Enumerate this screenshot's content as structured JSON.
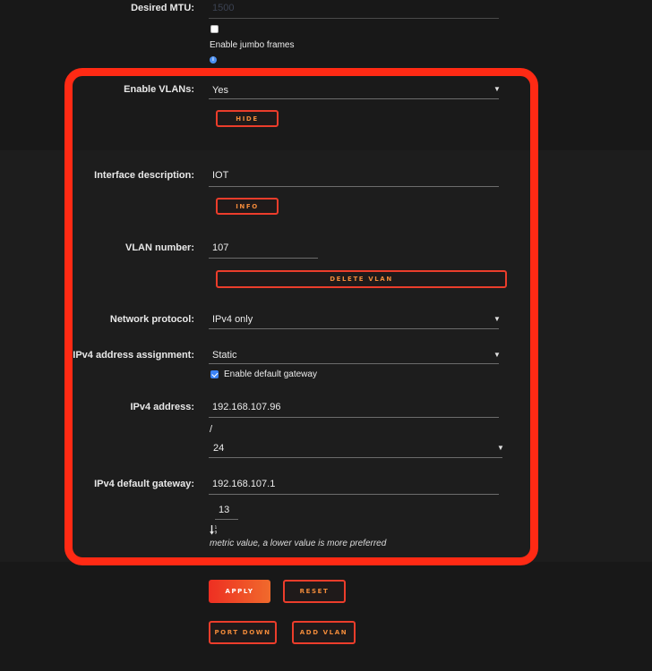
{
  "top": {
    "mtu_label": "Desired MTU:",
    "mtu_placeholder": "1500",
    "jumbo_label": "Enable jumbo frames",
    "info_glyph": "i"
  },
  "vlans": {
    "label": "Enable VLANs:",
    "value": "Yes",
    "hide_button": "HIDE"
  },
  "interface": {
    "desc_label": "Interface description:",
    "desc_value": "IOT",
    "info_button": "INFO",
    "vlan_label": "VLAN number:",
    "vlan_value": "107",
    "delete_button": "DELETE VLAN"
  },
  "protocol": {
    "label": "Network protocol:",
    "value": "IPv4 only"
  },
  "ipv4": {
    "assign_label": "IPv4 address assignment:",
    "assign_value": "Static",
    "gateway_checkbox_label": "Enable default gateway",
    "address_label": "IPv4 address:",
    "address_value": "192.168.107.96",
    "slash": "/",
    "prefix_value": "24",
    "gateway_label": "IPv4 default gateway:",
    "gateway_value": "192.168.107.1",
    "metric_value": "13",
    "metric_hint": "metric value, a lower value is more preferred"
  },
  "actions": {
    "apply": "APPLY",
    "reset": "RESET",
    "port_down": "PORT DOWN",
    "add_vlan": "ADD VLAN"
  },
  "colors": {
    "accent_red": "#ec3d2b",
    "accent_orange": "#f08a3a",
    "highlight": "#ff2a14",
    "checkbox_blue": "#3b82f6"
  }
}
